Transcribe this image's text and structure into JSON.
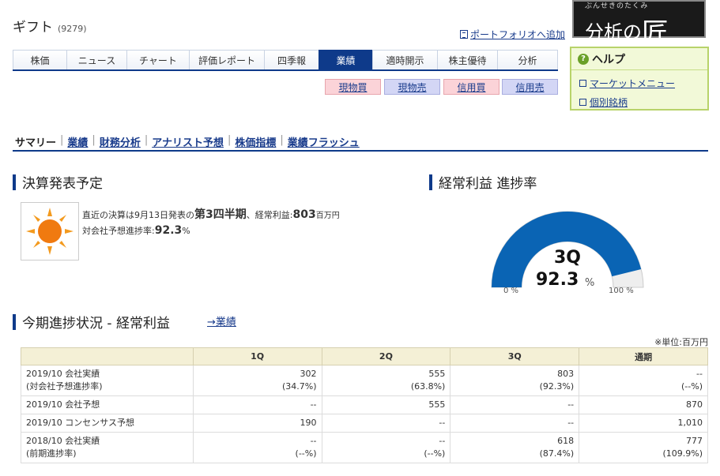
{
  "stock": {
    "name": "ギフト",
    "code": "(9279)"
  },
  "portfolio_link": "ポートフォリオへ追加",
  "tabs": [
    "株価",
    "ニュース",
    "チャート",
    "評価レポート",
    "四季報",
    "業績",
    "適時開示",
    "株主優待",
    "分析"
  ],
  "active_tab": "業績",
  "trade": {
    "buy_spot": "現物買",
    "sell_spot": "現物売",
    "buy_margin": "信用買",
    "sell_margin": "信用売"
  },
  "logo": {
    "ruby": "ぶんせきのたくみ",
    "text": "分析の",
    "big": "匠"
  },
  "help": {
    "title": "ヘルプ",
    "links": [
      "マーケットメニュー",
      "個別銘柄"
    ]
  },
  "subnav": [
    "サマリー",
    "業績",
    "財務分析",
    "アナリスト予想",
    "株価指標",
    "業績フラッシュ"
  ],
  "sections": {
    "announce": "決算発表予定",
    "progress": "経常利益 進捗率",
    "status": "今期進捗状況 - 経常利益"
  },
  "announce": {
    "prefix": "直近の決算は9月13日発表の",
    "period": "第3四半期",
    "mid": "、経常利益:",
    "value": "803",
    "unit": "百万円",
    "rate_label": "対会社予想進捗率:",
    "rate": "92.3",
    "rate_unit": "%"
  },
  "gauge": {
    "quarter": "3Q",
    "percent": "92.3",
    "unit": "%",
    "min_label": "0 %",
    "max_label": "100 %",
    "fraction": 0.923,
    "color": "#0a64b4",
    "track": "#eeeeee"
  },
  "gyoseki_link": "→業績",
  "unit_note": "※単位:百万円",
  "table": {
    "headers": [
      "",
      "1Q",
      "2Q",
      "3Q",
      "通期"
    ],
    "rows": [
      {
        "l1": "2019/10 会社実績",
        "l2": "(対会社予想進捗率)",
        "c": [
          [
            "302",
            "(34.7%)"
          ],
          [
            "555",
            "(63.8%)"
          ],
          [
            "803",
            "(92.3%)"
          ],
          [
            "--",
            "(--%)"
          ]
        ]
      },
      {
        "l1": "2019/10 会社予想",
        "l2": "",
        "c": [
          [
            "--",
            ""
          ],
          [
            "555",
            ""
          ],
          [
            "--",
            ""
          ],
          [
            "870",
            ""
          ]
        ]
      },
      {
        "l1": "2019/10 コンセンサス予想",
        "l2": "",
        "c": [
          [
            "190",
            ""
          ],
          [
            "--",
            ""
          ],
          [
            "--",
            ""
          ],
          [
            "1,010",
            ""
          ]
        ]
      },
      {
        "l1": "2018/10 会社実績",
        "l2": "(前期進捗率)",
        "c": [
          [
            "--",
            "(--%)"
          ],
          [
            "--",
            "(--%)"
          ],
          [
            "618",
            "(87.4%)"
          ],
          [
            "777",
            "(109.9%)"
          ]
        ]
      }
    ]
  }
}
